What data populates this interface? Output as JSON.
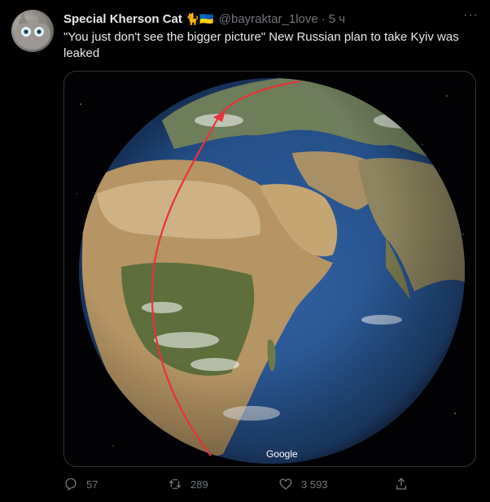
{
  "tweet": {
    "author_name": "Special Kherson Cat",
    "author_emoji": "🐈🇺🇦",
    "handle": "@bayraktar_1love",
    "separator": "·",
    "time": "5 ч",
    "more_label": "···",
    "text": "\"You just don't see the bigger picture\" New Russian plan to take Kyiv was leaked"
  },
  "media": {
    "watermark": "Google",
    "route_color": "#e8323a"
  },
  "actions": {
    "replies": "57",
    "retweets": "289",
    "likes": "3 593"
  }
}
